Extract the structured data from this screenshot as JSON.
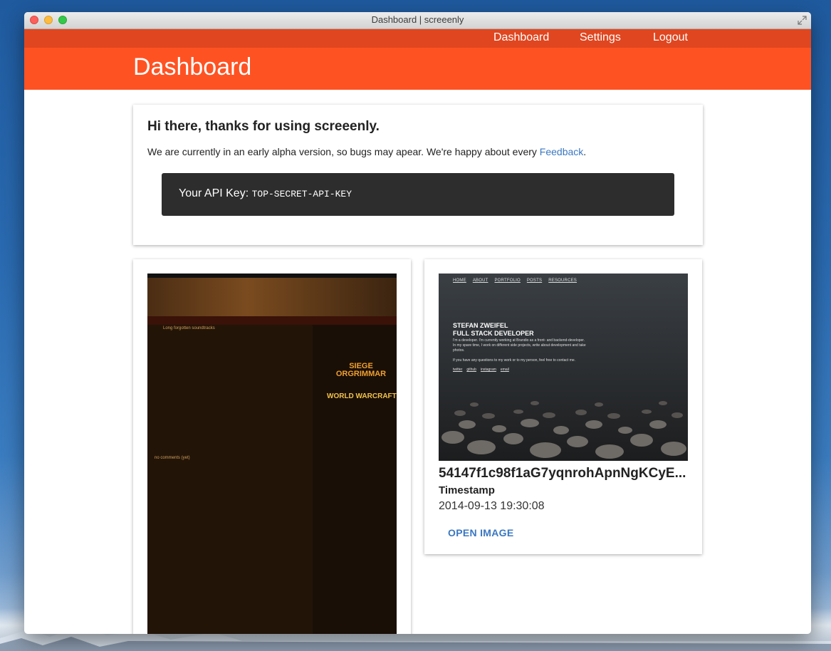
{
  "window": {
    "title": "Dashboard | screeenly"
  },
  "nav": {
    "items": [
      "Dashboard",
      "Settings",
      "Logout"
    ]
  },
  "header": {
    "title": "Dashboard"
  },
  "welcome": {
    "heading": "Hi there, thanks for using screeenly.",
    "text": "We are currently in an early alpha version, so bugs may apear. We're happy about every ",
    "feedback_link": "Feedback",
    "text_end": ".",
    "api_key_label": "Your API Key: ",
    "api_key_value": "TOP-SECRET-API-KEY"
  },
  "screenshots": [
    {
      "thumb_text": {
        "post_title": "Long forgotten soundtracks",
        "comments": "no comments (yet)",
        "logo_siege": "SIEGE ORGRIMMAR",
        "logo_wow": "WORLD WARCRAFT"
      }
    },
    {
      "id": "54147f1c98f1aG7yqnrohApnNgKCyE...",
      "timestamp_label": "Timestamp",
      "timestamp": "2014-09-13 19:30:08",
      "open_label": "OPEN IMAGE",
      "thumb_text": {
        "nav": [
          "HOME",
          "ABOUT",
          "PORTFOLIO",
          "POSTS",
          "RESOURCES"
        ],
        "name_line1": "STEFAN ZWEIFEL",
        "name_line2": "FULL STACK DEVELOPER",
        "bio": "I'm a developer. I'm currently working at Brandio as a front- and backend-developer. In my spare time, I work on different side projects, write about development and take photos.",
        "contact": "If you have any questions to my work or to my person, feel free to contact me.",
        "links": [
          "twitter",
          "github",
          "instagram",
          "email"
        ]
      }
    }
  ],
  "colors": {
    "nav_bar": "#e0461f",
    "header": "#ff5222",
    "link": "#3a77c2",
    "api_box": "#2d2d2d"
  }
}
